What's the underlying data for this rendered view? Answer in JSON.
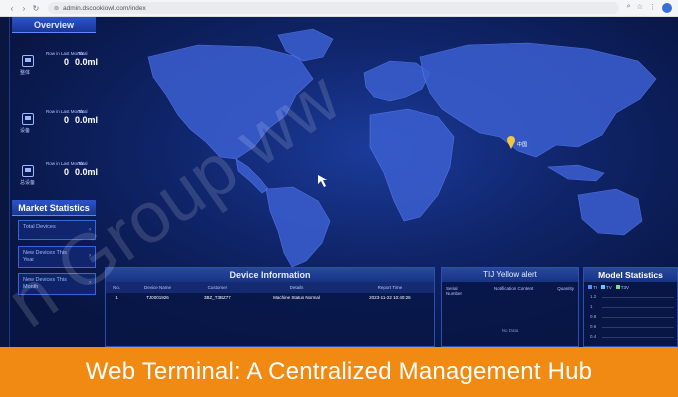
{
  "browser": {
    "url": "admin.dscookiowl.com/index",
    "nav": {
      "back": "‹",
      "forward": "›",
      "reload": "↻"
    },
    "tools": [
      "⌕",
      "☆",
      "⋮"
    ]
  },
  "overview": {
    "title": "Overview",
    "cards": [
      {
        "sub": "整体",
        "label1": "Row in Last Month",
        "label2": "Total",
        "value1": "0",
        "value2": "0.0ml"
      },
      {
        "sub": "设备",
        "label1": "Row in Last Month",
        "label2": "Total",
        "value1": "0",
        "value2": "0.0ml"
      },
      {
        "sub": "总设备",
        "label1": "Row in Last Month",
        "label2": "Total",
        "value1": "0",
        "value2": "0.0ml"
      }
    ]
  },
  "market": {
    "title": "Market Statistics",
    "items": [
      {
        "label": "Total Devices",
        "arrow": "›"
      },
      {
        "label": "New Devices This Year",
        "arrow": "›"
      },
      {
        "label": "New Devices This Month",
        "arrow": "›"
      }
    ]
  },
  "map": {
    "pin_label": "中国"
  },
  "device_info": {
    "title": "Device Information",
    "columns": [
      "No.",
      "Device Name",
      "Customer",
      "Details",
      "Report Time"
    ],
    "rows": [
      [
        "1",
        "TJ0001926",
        "3BZ_T3BZ77",
        "Machine Status Normal",
        "2023-11-22 10:40:26"
      ]
    ]
  },
  "tj_alert": {
    "title": "TIJ Yellow alert",
    "columns": [
      "Serial Number",
      "Notification Content",
      "Quantity"
    ],
    "empty": "No Data"
  },
  "model_stats": {
    "title": "Model Statistics",
    "legend": [
      "TI",
      "TV",
      "T3V"
    ],
    "yticks": [
      "1.2",
      "1",
      "0.8",
      "0.6",
      "0.4",
      "0.2"
    ]
  },
  "watermark": "n Group ww",
  "banner": {
    "text": "Web Terminal: A Centralized Management Hub"
  },
  "colors": {
    "banner": "#f08a12",
    "panel_header": "#2c54c9",
    "background": "#0b1a4d"
  }
}
